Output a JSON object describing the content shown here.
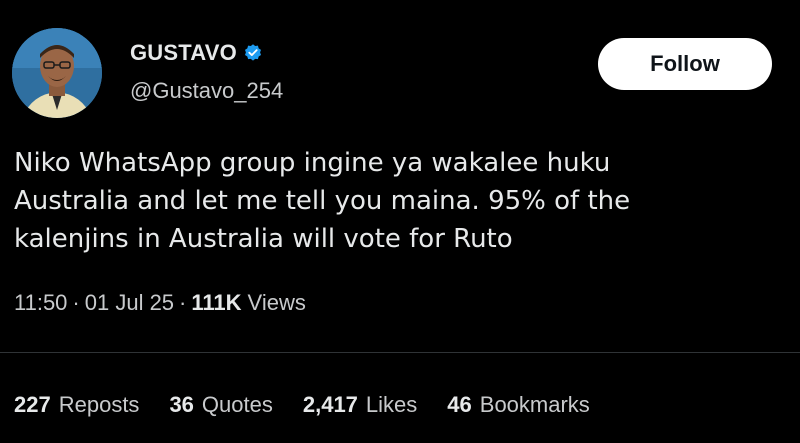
{
  "profile": {
    "display_name": "GUSTAVO",
    "handle": "@Gustavo_254",
    "verified_icon": "verified-badge-icon",
    "verified_color": "#1d9bf0"
  },
  "follow_button": {
    "label": "Follow"
  },
  "tweet": {
    "text": "Niko WhatsApp group ingine ya wakalee huku\nAustralia and let me tell you maina. 95% of the\nkalenjins in Australia will vote for Ruto",
    "time": "11:50",
    "separator": "·",
    "date": "01 Jul 25",
    "views_count": "111K",
    "views_label": "Views"
  },
  "stats": [
    {
      "count": "227",
      "label": "Reposts"
    },
    {
      "count": "36",
      "label": "Quotes"
    },
    {
      "count": "2,417",
      "label": "Likes"
    },
    {
      "count": "46",
      "label": "Bookmarks"
    }
  ],
  "colors": {
    "background": "#000000",
    "text_primary": "#e7e9ea",
    "text_secondary": "#c8cacc",
    "divider": "#2f3336",
    "button_bg": "#ffffff"
  }
}
